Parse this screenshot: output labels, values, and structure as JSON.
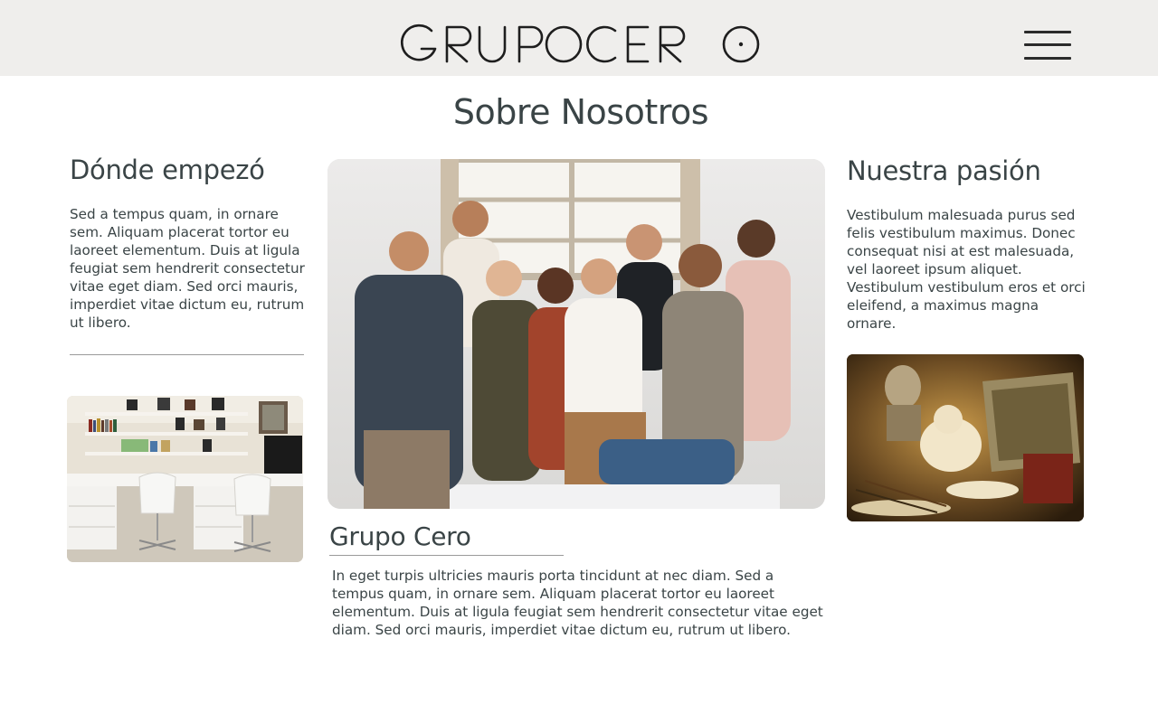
{
  "header": {
    "logo_text": "GRUPOCERO",
    "menu_icon": "hamburger-menu-icon"
  },
  "page": {
    "title": "Sobre Nosotros"
  },
  "left": {
    "heading": "Dónde empezó",
    "text": " Sed a tempus quam, in ornare sem. Aliquam placerat tortor eu laoreet elementum. Duis at ligula feugiat sem hendrerit consectetur vitae eget diam. Sed orci mauris, imperdiet vitae dictum eu, rutrum ut libero.",
    "image": "office-workspace-image"
  },
  "center": {
    "image": "team-group-photo",
    "heading": "Grupo Cero",
    "text": "In eget turpis ultricies mauris porta tincidunt at nec diam. Sed a tempus quam, in ornare sem. Aliquam placerat tortor eu laoreet elementum. Duis at ligula feugiat sem hendrerit consectetur vitae eget diam. Sed orci mauris, imperdiet vitae dictum eu, rutrum ut libero."
  },
  "right": {
    "heading": "Nuestra pasión",
    "text": "Vestibulum malesuada purus sed felis vestibulum maximus. Donec consequat nisi at est malesuada, vel laoreet ipsum aliquet. Vestibulum vestibulum eros et orci eleifend, a maximus magna ornare.",
    "image": "still-life-painting-image"
  },
  "colors": {
    "header_bg": "#efeeec",
    "text": "#3a4446",
    "rule": "#9a9a9a"
  }
}
